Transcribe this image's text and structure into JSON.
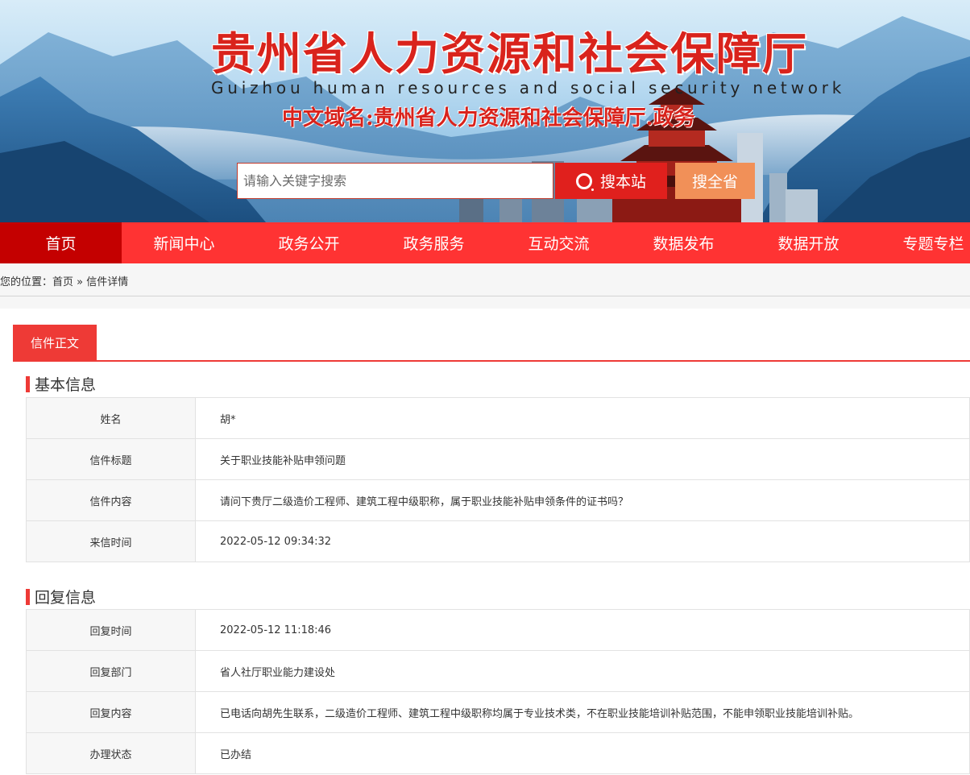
{
  "header": {
    "title": "贵州省人力资源和社会保障厅",
    "subtitle": "Guizhou human resources and social security network",
    "domain_line": "中文域名:贵州省人力资源和社会保障厅.政务"
  },
  "search": {
    "placeholder": "请输入关键字搜索",
    "value": "",
    "site_button": "搜本站",
    "province_button": "搜全省"
  },
  "nav": {
    "items": [
      {
        "label": "首页",
        "active": true
      },
      {
        "label": "新闻中心"
      },
      {
        "label": "政务公开"
      },
      {
        "label": "政务服务"
      },
      {
        "label": "互动交流"
      },
      {
        "label": "数据发布"
      },
      {
        "label": "数据开放"
      },
      {
        "label": "专题专栏"
      }
    ]
  },
  "breadcrumb": {
    "prefix": "您的位置：",
    "home": "首页",
    "separator": " » ",
    "current": "信件详情"
  },
  "tabs": {
    "active": "信件正文"
  },
  "basic_info": {
    "heading": "基本信息",
    "rows": [
      {
        "label": "姓名",
        "value": "胡*"
      },
      {
        "label": "信件标题",
        "value": "关于职业技能补贴申领问题"
      },
      {
        "label": "信件内容",
        "value": "请问下贵厅二级造价工程师、建筑工程中级职称，属于职业技能补贴申领条件的证书吗？"
      },
      {
        "label": "来信时间",
        "value": "2022-05-12 09:34:32"
      }
    ]
  },
  "reply_info": {
    "heading": "回复信息",
    "rows": [
      {
        "label": "回复时间",
        "value": "2022-05-12 11:18:46"
      },
      {
        "label": "回复部门",
        "value": "省人社厅职业能力建设处"
      },
      {
        "label": "回复内容",
        "value": "已电话向胡先生联系，二级造价工程师、建筑工程中级职称均属于专业技术类，不在职业技能培训补贴范围，不能申领职业技能培训补贴。"
      },
      {
        "label": "办理状态",
        "value": "已办结"
      }
    ]
  },
  "colors": {
    "brand_red": "#ff3333",
    "nav_active": "#c40000",
    "accent": "#ee3a36",
    "search_province": "#f19058"
  }
}
